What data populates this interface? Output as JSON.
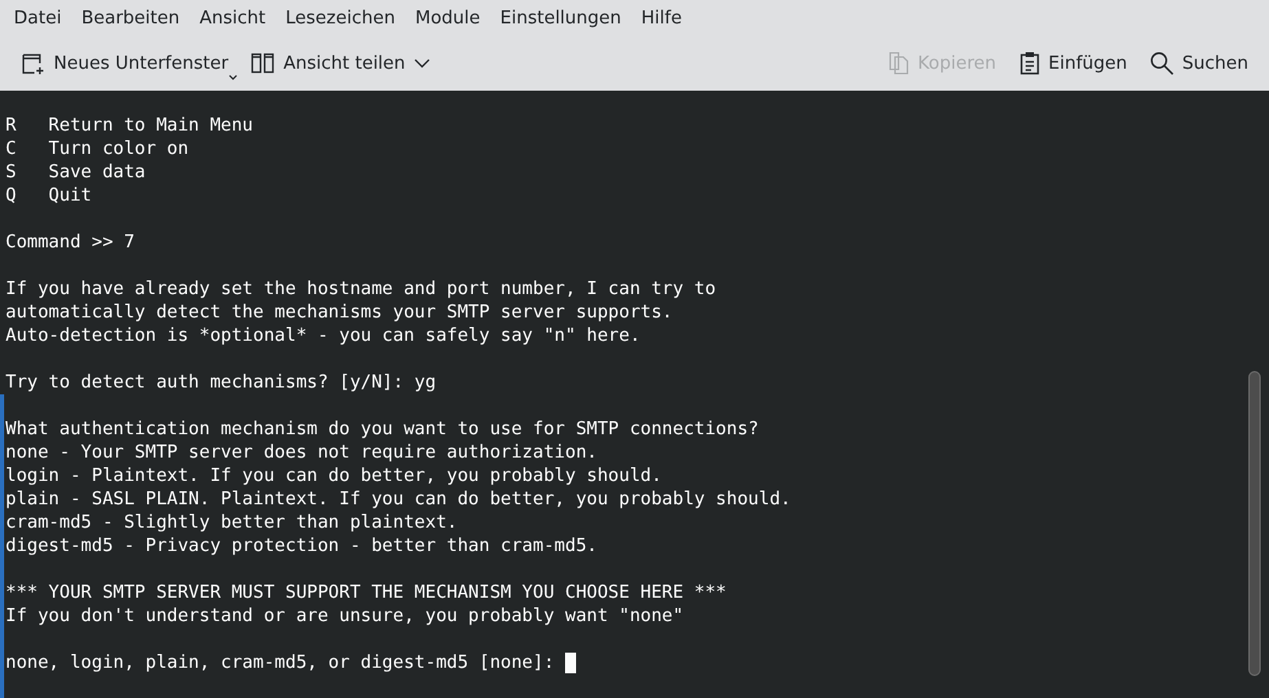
{
  "menu": [
    "Datei",
    "Bearbeiten",
    "Ansicht",
    "Lesezeichen",
    "Module",
    "Einstellungen",
    "Hilfe"
  ],
  "toolbar": {
    "left": [
      {
        "kind": "new-tab",
        "label": "Neues Unterfenster",
        "disabled": false
      },
      {
        "kind": "split",
        "label": "Ansicht teilen",
        "disabled": false
      }
    ],
    "right": [
      {
        "kind": "copy",
        "label": "Kopieren",
        "disabled": true
      },
      {
        "kind": "paste",
        "label": "Einfügen",
        "disabled": false
      },
      {
        "kind": "search",
        "label": "Suchen",
        "disabled": false
      }
    ]
  },
  "terminal": {
    "blocks": [
      [
        "R   Return to Main Menu",
        "C   Turn color on",
        "S   Save data",
        "Q   Quit"
      ],
      [
        "Command >> 7"
      ],
      [
        "If you have already set the hostname and port number, I can try to",
        "automatically detect the mechanisms your SMTP server supports.",
        "Auto-detection is *optional* - you can safely say \"n\" here."
      ],
      [
        "Try to detect auth mechanisms? [y/N]: yg"
      ],
      [
        "What authentication mechanism do you want to use for SMTP connections?",
        "none - Your SMTP server does not require authorization.",
        "login - Plaintext. If you can do better, you probably should.",
        "plain - SASL PLAIN. Plaintext. If you can do better, you probably should.",
        "cram-md5 - Slightly better than plaintext.",
        "digest-md5 - Privacy protection - better than cram-md5."
      ],
      [
        "*** YOUR SMTP SERVER MUST SUPPORT THE MECHANISM YOU CHOOSE HERE ***",
        "If you don't understand or are unsure, you probably want \"none\""
      ]
    ],
    "prompt": "none, login, plain, cram-md5, or digest-md5 [none]:"
  }
}
